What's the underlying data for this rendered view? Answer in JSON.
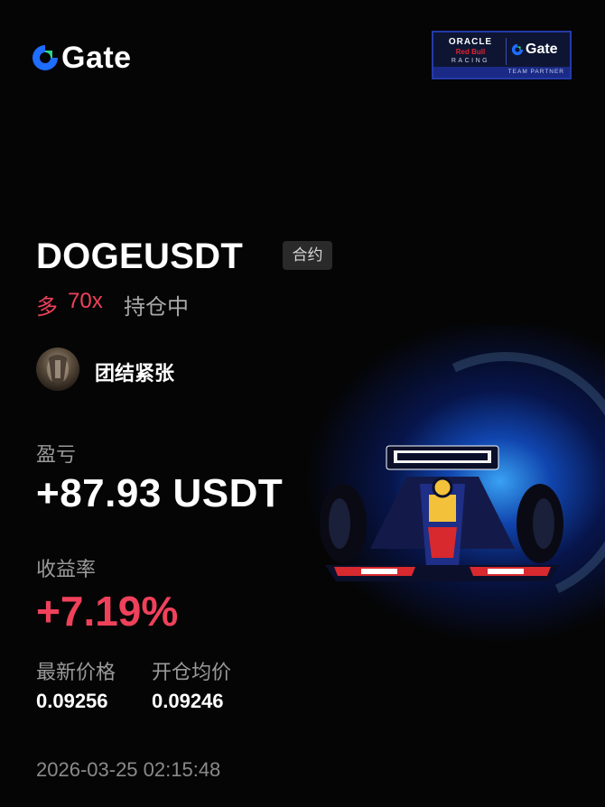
{
  "brand": {
    "name": "Gate",
    "blue": "#1e6dff",
    "green": "#2ad68a"
  },
  "partner": {
    "oracle": "ORACLE",
    "redbull": "Red Bull",
    "racing": "RACING",
    "gate": "Gate",
    "tagline": "TEAM PARTNER"
  },
  "position": {
    "symbol": "DOGEUSDT",
    "type_badge": "合约",
    "side": "多",
    "leverage": "70x",
    "status": "持仓中"
  },
  "user": {
    "name": "团结紧张"
  },
  "pnl": {
    "label": "盈亏",
    "value": "+87.93 USDT"
  },
  "roi": {
    "label": "收益率",
    "value": "+7.19%"
  },
  "prices": {
    "last_label": "最新价格",
    "last_value": "0.09256",
    "entry_label": "开仓均价",
    "entry_value": "0.09246"
  },
  "timestamp": "2026-03-25 02:15:48",
  "colors": {
    "positive": "#f0415b",
    "muted": "#9a9a9a",
    "badge_bg": "#2a2a2a"
  }
}
